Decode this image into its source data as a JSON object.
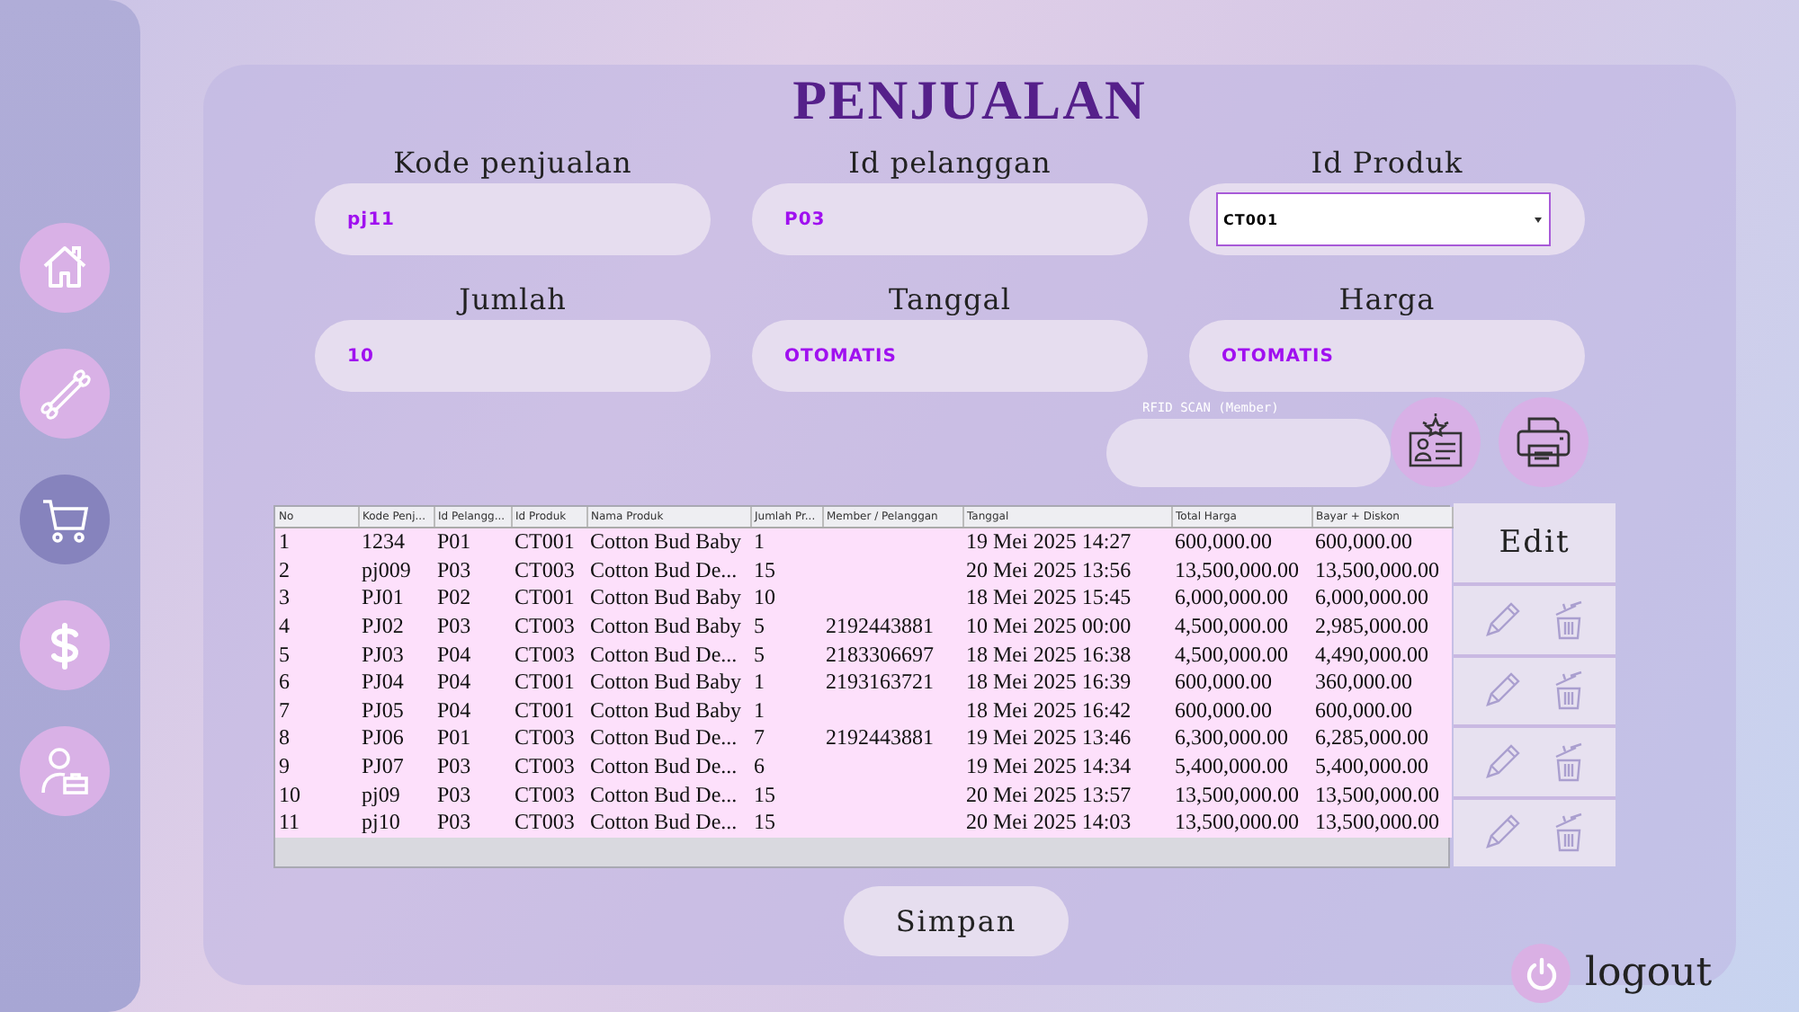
{
  "sidebar": {
    "items": [
      {
        "kind": "home",
        "selected": false
      },
      {
        "kind": "swab",
        "selected": false
      },
      {
        "kind": "cart",
        "selected": true
      },
      {
        "kind": "dollar",
        "selected": false
      },
      {
        "kind": "user",
        "selected": false
      }
    ]
  },
  "title": "PENJUALAN",
  "form": {
    "fields": [
      {
        "label": "Kode penjualan",
        "value": "pj11",
        "kind": "text"
      },
      {
        "label": "Id pelanggan",
        "value": "P03",
        "kind": "text"
      },
      {
        "label": "Id Produk",
        "value": "CT001",
        "kind": "dropdown"
      },
      {
        "label": "Jumlah",
        "value": "10",
        "kind": "text"
      },
      {
        "label": "Tanggal",
        "value": "OTOMATIS",
        "kind": "text"
      },
      {
        "label": "Harga",
        "value": "OTOMATIS",
        "kind": "text"
      }
    ],
    "rfid": {
      "label": "RFID SCAN (Member)"
    }
  },
  "table": {
    "columns": [
      "No",
      "Kode Penj...",
      "Id Pelangg...",
      "Id Produk",
      "Nama Produk",
      "Jumlah Pr...",
      "Member / Pelanggan",
      "Tanggal",
      "Total Harga",
      "Bayar + Diskon"
    ],
    "rows": [
      [
        "1",
        "1234",
        "P01",
        "CT001",
        "Cotton Bud Baby",
        "1",
        null,
        "19 Mei 2025 14:27",
        "600,000.00",
        "600,000.00"
      ],
      [
        "2",
        "pj009",
        "P03",
        "CT003",
        "Cotton Bud De...",
        "15",
        null,
        "20 Mei 2025 13:56",
        "13,500,000.00",
        "13,500,000.00"
      ],
      [
        "3",
        "PJ01",
        "P02",
        "CT001",
        "Cotton Bud Baby",
        "10",
        null,
        "18 Mei 2025 15:45",
        "6,000,000.00",
        "6,000,000.00"
      ],
      [
        "4",
        "PJ02",
        "P03",
        "CT003",
        "Cotton Bud Baby",
        "5",
        "2192443881",
        "10 Mei 2025 00:00",
        "4,500,000.00",
        "2,985,000.00"
      ],
      [
        "5",
        "PJ03",
        "P04",
        "CT003",
        "Cotton Bud De...",
        "5",
        "2183306697",
        "18 Mei 2025 16:38",
        "4,500,000.00",
        "4,490,000.00"
      ],
      [
        "6",
        "PJ04",
        "P04",
        "CT001",
        "Cotton Bud Baby",
        "1",
        "2193163721",
        "18 Mei 2025 16:39",
        "600,000.00",
        "360,000.00"
      ],
      [
        "7",
        "PJ05",
        "P04",
        "CT001",
        "Cotton Bud Baby",
        "1",
        null,
        "18 Mei 2025 16:42",
        "600,000.00",
        "600,000.00"
      ],
      [
        "8",
        "PJ06",
        "P01",
        "CT003",
        "Cotton Bud De...",
        "7",
        "2192443881",
        "19 Mei 2025 13:46",
        "6,300,000.00",
        "6,285,000.00"
      ],
      [
        "9",
        "PJ07",
        "P03",
        "CT003",
        "Cotton Bud De...",
        "6",
        null,
        "19 Mei 2025 14:34",
        "5,400,000.00",
        "5,400,000.00"
      ],
      [
        "10",
        "pj09",
        "P03",
        "CT003",
        "Cotton Bud De...",
        "15",
        null,
        "20 Mei 2025 13:57",
        "13,500,000.00",
        "13,500,000.00"
      ],
      [
        "11",
        "pj10",
        "P03",
        "CT003",
        "Cotton Bud De...",
        "15",
        null,
        "20 Mei 2025 14:03",
        "13,500,000.00",
        "13,500,000.00"
      ]
    ]
  },
  "actions": {
    "edit": "Edit",
    "rows": [
      {
        "kind": "edit-delete"
      },
      {
        "kind": "edit-delete"
      },
      {
        "kind": "edit-delete"
      },
      {
        "kind": "edit-delete"
      }
    ]
  },
  "save_button": "Simpan",
  "logout": "logout"
}
